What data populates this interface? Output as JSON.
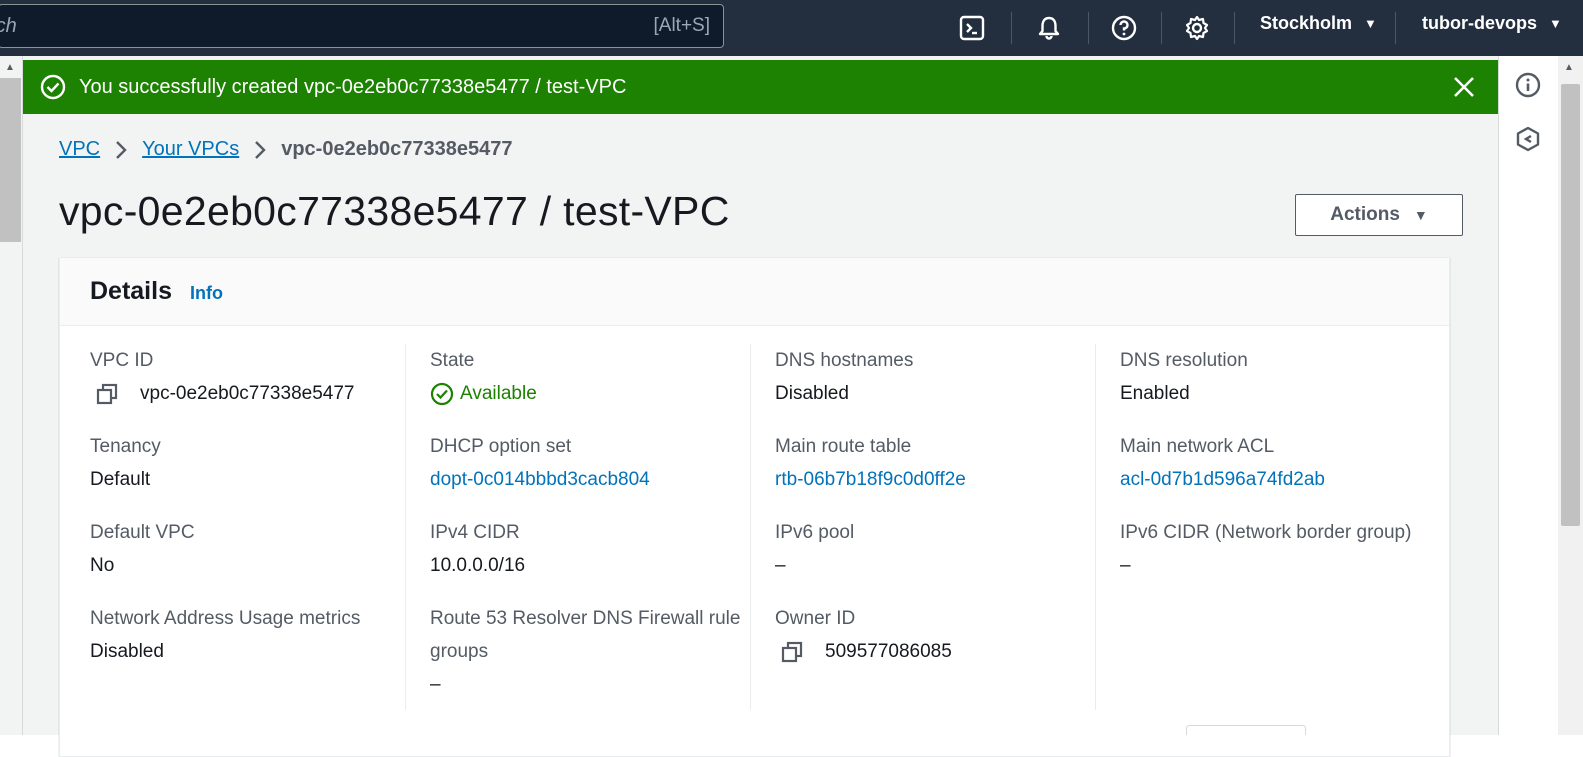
{
  "topnav": {
    "search_text": "rch",
    "search_shortcut": "[Alt+S]",
    "region": "Stockholm",
    "account": "tubor-devops"
  },
  "flash": {
    "message": "You successfully created vpc-0e2eb0c77338e5477 / test-VPC",
    "color": "#1d8102"
  },
  "breadcrumb": {
    "items": [
      "VPC",
      "Your VPCs"
    ],
    "current": "vpc-0e2eb0c77338e5477"
  },
  "page": {
    "title": "vpc-0e2eb0c77338e5477 / test-VPC",
    "actions_label": "Actions"
  },
  "details": {
    "title": "Details",
    "info_label": "Info",
    "columns": [
      [
        {
          "label": "VPC ID",
          "value": "vpc-0e2eb0c77338e5477",
          "copy": true
        },
        {
          "label": "Tenancy",
          "value": "Default"
        },
        {
          "label": "Default VPC",
          "value": "No"
        },
        {
          "label": "Network Address Usage metrics",
          "value": "Disabled"
        }
      ],
      [
        {
          "label": "State",
          "value": "Available",
          "status": "ok"
        },
        {
          "label": "DHCP option set",
          "value": "dopt-0c014bbbd3cacb804",
          "link": true
        },
        {
          "label": "IPv4 CIDR",
          "value": "10.0.0.0/16"
        },
        {
          "label": "Route 53 Resolver DNS Firewall rule groups",
          "value": "–"
        }
      ],
      [
        {
          "label": "DNS hostnames",
          "value": "Disabled"
        },
        {
          "label": "Main route table",
          "value": "rtb-06b7b18f9c0d0ff2e",
          "link": true
        },
        {
          "label": "IPv6 pool",
          "value": "–"
        },
        {
          "label": "Owner ID",
          "value": "509577086085",
          "copy": true
        }
      ],
      [
        {
          "label": "DNS resolution",
          "value": "Enabled"
        },
        {
          "label": "Main network ACL",
          "value": "acl-0d7b1d596a74fd2ab",
          "link": true
        },
        {
          "label": "IPv6 CIDR (Network border group)",
          "value": "–"
        }
      ]
    ]
  },
  "icons": {
    "cloudshell": "terminal-icon",
    "notifications": "bell-icon",
    "help": "help-icon",
    "settings": "gear-icon",
    "info_panel": "info-icon",
    "tools_panel": "hexagon-icon"
  }
}
